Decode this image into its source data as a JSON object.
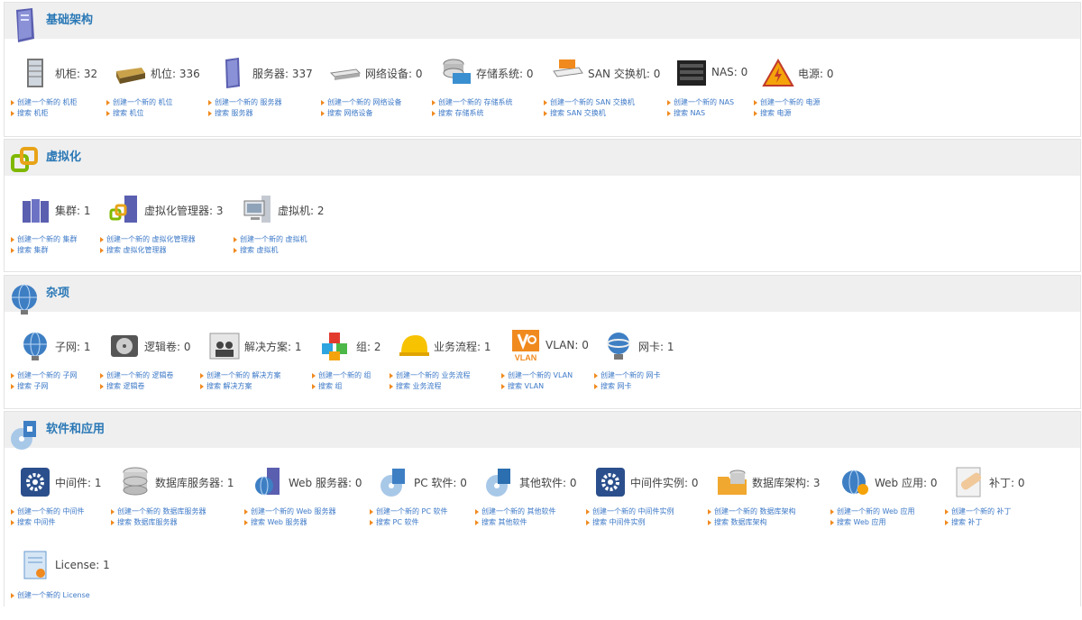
{
  "sections": [
    {
      "title": "基础架构",
      "items": [
        {
          "label": "机柜: 32",
          "create": "创建一个新的 机柜",
          "search": "搜索 机柜"
        },
        {
          "label": "机位: 336",
          "create": "创建一个新的 机位",
          "search": "搜索 机位"
        },
        {
          "label": "服务器: 337",
          "create": "创建一个新的 服务器",
          "search": "搜索 服务器"
        },
        {
          "label": "网络设备: 0",
          "create": "创建一个新的 网络设备",
          "search": "搜索 网络设备"
        },
        {
          "label": "存储系统: 0",
          "create": "创建一个新的 存储系统",
          "search": "搜索 存储系统"
        },
        {
          "label": "SAN 交换机: 0",
          "create": "创建一个新的 SAN 交换机",
          "search": "搜索 SAN 交换机"
        },
        {
          "label": "NAS: 0",
          "create": "创建一个新的 NAS",
          "search": "搜索 NAS"
        },
        {
          "label": "电源: 0",
          "create": "创建一个新的 电源",
          "search": "搜索 电源"
        }
      ]
    },
    {
      "title": "虚拟化",
      "items": [
        {
          "label": "集群: 1",
          "create": "创建一个新的 集群",
          "search": "搜索 集群"
        },
        {
          "label": "虚拟化管理器: 3",
          "create": "创建一个新的 虚拟化管理器",
          "search": "搜索 虚拟化管理器"
        },
        {
          "label": "虚拟机: 2",
          "create": "创建一个新的 虚拟机",
          "search": "搜索 虚拟机"
        }
      ]
    },
    {
      "title": "杂项",
      "items": [
        {
          "label": "子网: 1",
          "create": "创建一个新的 子网",
          "search": "搜索 子网"
        },
        {
          "label": "逻辑卷: 0",
          "create": "创建一个新的 逻辑卷",
          "search": "搜索 逻辑卷"
        },
        {
          "label": "解决方案: 1",
          "create": "创建一个新的 解决方案",
          "search": "搜索 解决方案"
        },
        {
          "label": "组: 2",
          "create": "创建一个新的 组",
          "search": "搜索 组"
        },
        {
          "label": "业务流程: 1",
          "create": "创建一个新的 业务流程",
          "search": "搜索 业务流程"
        },
        {
          "label": "VLAN: 0",
          "create": "创建一个新的 VLAN",
          "search": "搜索 VLAN",
          "icon_text": "VLAN"
        },
        {
          "label": "网卡: 1",
          "create": "创建一个新的 网卡",
          "search": "搜索 网卡"
        }
      ]
    },
    {
      "title": "软件和应用",
      "items": [
        {
          "label": "中间件: 1",
          "create": "创建一个新的 中间件",
          "search": "搜索 中间件"
        },
        {
          "label": "数据库服务器: 1",
          "create": "创建一个新的 数据库服务器",
          "search": "搜索 数据库服务器"
        },
        {
          "label": "Web 服务器: 0",
          "create": "创建一个新的 Web 服务器",
          "search": "搜索 Web 服务器"
        },
        {
          "label": "PC 软件: 0",
          "create": "创建一个新的 PC 软件",
          "search": "搜索 PC 软件"
        },
        {
          "label": "其他软件: 0",
          "create": "创建一个新的 其他软件",
          "search": "搜索 其他软件"
        },
        {
          "label": "中间件实例: 0",
          "create": "创建一个新的 中间件实例",
          "search": "搜索 中间件实例"
        },
        {
          "label": "数据库架构: 3",
          "create": "创建一个新的 数据库架构",
          "search": "搜索 数据库架构"
        },
        {
          "label": "Web 应用: 0",
          "create": "创建一个新的 Web 应用",
          "search": "搜索 Web 应用"
        },
        {
          "label": "补丁: 0",
          "create": "创建一个新的 补丁",
          "search": "搜索 补丁"
        },
        {
          "label": "License: 1",
          "create": "创建一个新的 License"
        }
      ]
    }
  ],
  "icons": {
    "s0": [
      "rack-icon",
      "enclosure-icon",
      "server-icon",
      "network-device-icon",
      "storage-system-icon",
      "san-switch-icon",
      "nas-icon",
      "power-warning-icon"
    ],
    "s1": [
      "cluster-icon",
      "hypervisor-icon",
      "virtual-machine-icon"
    ],
    "s2": [
      "subnet-globe-icon",
      "logical-volume-icon",
      "solution-icon",
      "group-cubes-icon",
      "business-process-helmet-icon",
      "vlan-icon",
      "network-card-icon"
    ],
    "s3": [
      "middleware-gear-icon",
      "database-server-icon",
      "web-server-icon",
      "pc-software-icon",
      "other-software-icon",
      "middleware-instance-gear-icon",
      "database-schema-icon",
      "web-application-icon",
      "patch-icon",
      "license-icon"
    ],
    "headers": [
      "infrastructure-server-icon",
      "virtualization-icon",
      "misc-globe-icon",
      "software-cd-icon"
    ]
  },
  "colors": {
    "title": "#2a78b6",
    "link": "#3d79c7",
    "bullet": "#f08a1f",
    "header_bg": "#efefef"
  }
}
